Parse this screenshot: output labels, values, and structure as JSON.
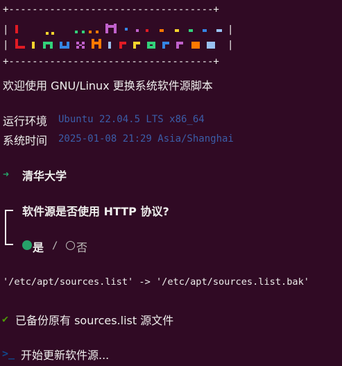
{
  "banner": {
    "border_top": "+-----------------------------------+",
    "border_bottom": "+-----------------------------------+",
    "pipe": "|",
    "logo_text": "LinuxMirrors"
  },
  "welcome": {
    "text": "欢迎使用 GNU/Linux 更换系统软件源脚本"
  },
  "env": {
    "label": "运行环境",
    "value": "Ubuntu 22.04.5 LTS x86_64"
  },
  "time": {
    "label": "系统时间",
    "value": "2025-01-08 21:29 Asia/Shanghai"
  },
  "mirror": {
    "arrow": "➜",
    "name": "清华大学"
  },
  "question": {
    "text": "软件源是否使用 HTTP 协议?",
    "yes_label": "是",
    "separator": "/",
    "no_label": "否",
    "selected": "yes"
  },
  "backup_cmd": {
    "text": "'/etc/apt/sources.list' -> '/etc/apt/sources.list.bak'"
  },
  "backup_done": {
    "check": "✔",
    "text": "已备份原有 sources.list 源文件"
  },
  "update": {
    "prompt": ">_",
    "text": "开始更新软件源..."
  },
  "colors": {
    "background": "#300a24",
    "foreground": "#eeeeec",
    "dim_blue": "#3b5da8",
    "green": "#26a269",
    "logo_palette": [
      "#e01b24",
      "#f6d32d",
      "#33d17a",
      "#3584e4",
      "#c061cb",
      "#ff7800",
      "#99c1f1"
    ]
  }
}
